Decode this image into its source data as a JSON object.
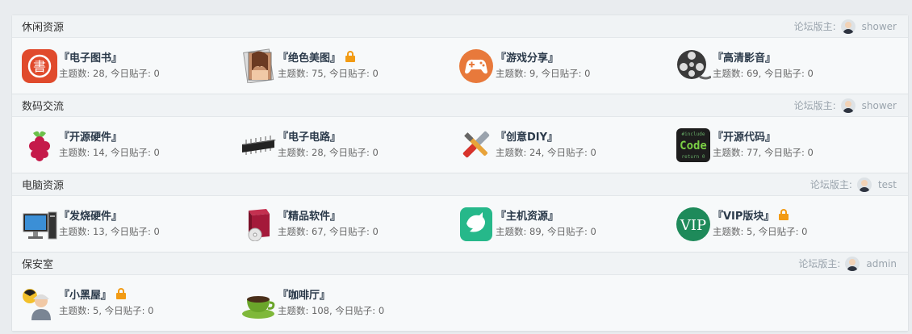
{
  "categories": [
    {
      "title": "休闲资源",
      "mod_label": "论坛版主:",
      "moderator": "shower",
      "forums": [
        {
          "name": "『电子图书』",
          "stats": "主题数: 28, 今日贴子: 0",
          "icon": "ebook-icon",
          "locked": false
        },
        {
          "name": "『绝色美图』",
          "stats": "主题数: 75, 今日贴子: 0",
          "icon": "photo-icon",
          "locked": true
        },
        {
          "name": "『游戏分享』",
          "stats": "主题数: 9, 今日贴子: 0",
          "icon": "gamepad-icon",
          "locked": false
        },
        {
          "name": "『高清影音』",
          "stats": "主题数: 69, 今日贴子: 0",
          "icon": "film-reel-icon",
          "locked": false
        }
      ]
    },
    {
      "title": "数码交流",
      "mod_label": "论坛版主:",
      "moderator": "shower",
      "forums": [
        {
          "name": "『开源硬件』",
          "stats": "主题数: 14, 今日贴子: 0",
          "icon": "raspberry-icon",
          "locked": false
        },
        {
          "name": "『电子电路』",
          "stats": "主题数: 28, 今日贴子: 0",
          "icon": "chip-icon",
          "locked": false
        },
        {
          "name": "『创意DIY』",
          "stats": "主题数: 24, 今日贴子: 0",
          "icon": "tools-icon",
          "locked": false
        },
        {
          "name": "『开源代码』",
          "stats": "主题数: 77, 今日贴子: 0",
          "icon": "code-icon",
          "locked": false
        }
      ]
    },
    {
      "title": "电脑资源",
      "mod_label": "论坛版主:",
      "moderator": "test",
      "forums": [
        {
          "name": "『发烧硬件』",
          "stats": "主题数: 13, 今日贴子: 0",
          "icon": "desktop-icon",
          "locked": false
        },
        {
          "name": "『精品软件』",
          "stats": "主题数: 67, 今日贴子: 0",
          "icon": "software-box-icon",
          "locked": false
        },
        {
          "name": "『主机资源』",
          "stats": "主题数: 89, 今日贴子: 0",
          "icon": "dove-icon",
          "locked": false
        },
        {
          "name": "『VIP版块』",
          "stats": "主题数: 5, 今日贴子: 0",
          "icon": "vip-icon",
          "locked": true
        }
      ]
    },
    {
      "title": "保安室",
      "mod_label": "论坛版主:",
      "moderator": "admin",
      "forums": [
        {
          "name": "『小黑屋』",
          "stats": "主题数: 5, 今日贴子: 0",
          "icon": "worker-icon",
          "locked": true
        },
        {
          "name": "『咖啡厅』",
          "stats": "主题数: 108, 今日贴子: 0",
          "icon": "coffee-cup-icon",
          "locked": false
        }
      ]
    }
  ],
  "icon_text": {
    "ebook": "書",
    "code_top": "#include",
    "code": "Code",
    "code_bottom": "return 0",
    "vip": "VIP"
  },
  "colors": {
    "lock": "#f29b14",
    "title": "#2b3a4a",
    "stats": "#666666",
    "moderator": "#9aa4ad"
  }
}
